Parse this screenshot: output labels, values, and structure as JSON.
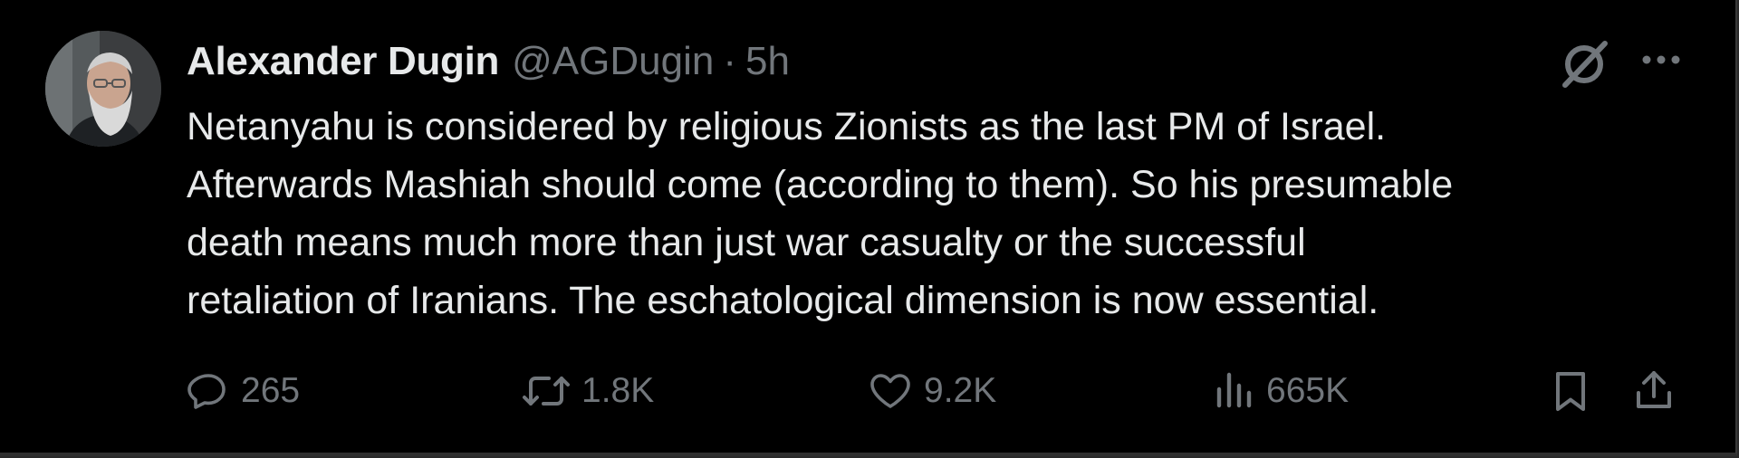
{
  "tweet": {
    "author": {
      "name": "Alexander Dugin",
      "handle": "@AGDugin",
      "separator": "·",
      "time": "5h",
      "avatar": "avatar-photo"
    },
    "text_lines": [
      "Netanyahu is considered by religious Zionists as the last PM of Israel.",
      "Afterwards Mashiah should come (according to them). So his presumable",
      "death means much more than just war casualty or the successful",
      "retaliation of Iranians. The eschatological dimension is now essential."
    ],
    "header_icons": [
      "grok-icon",
      "more-options-icon"
    ],
    "actions": {
      "replies": "265",
      "reposts": "1.8K",
      "likes": "9.2K",
      "views": "665K"
    },
    "action_icons": [
      "reply-icon",
      "repost-icon",
      "like-icon",
      "views-icon",
      "bookmark-icon",
      "share-icon"
    ]
  },
  "colors": {
    "background": "#000000",
    "primary_text": "#e7e9ea",
    "secondary_text": "#71767b"
  }
}
